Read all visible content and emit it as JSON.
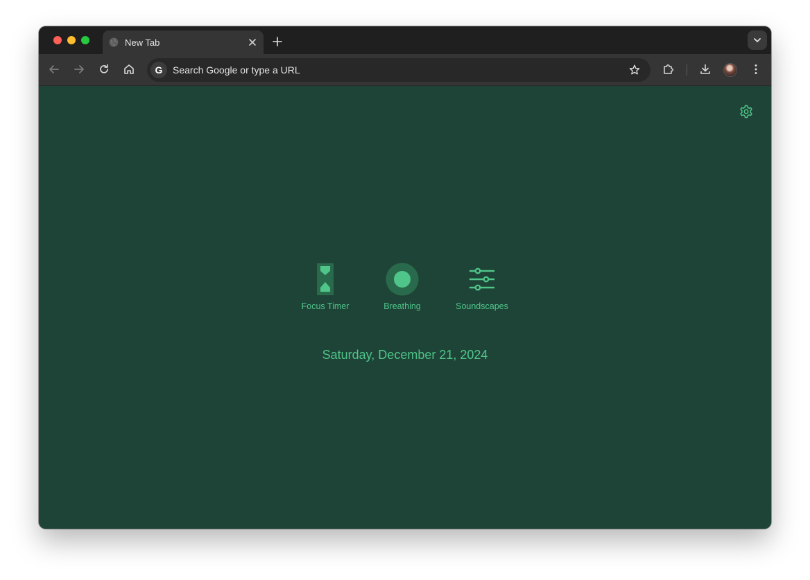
{
  "browser": {
    "tab": {
      "title": "New Tab"
    },
    "omnibox": {
      "placeholder": "Search Google or type a URL",
      "engine_logo": "G"
    }
  },
  "icons": {
    "back": "arrow-left-icon",
    "forward": "arrow-right-icon",
    "reload": "reload-icon",
    "home": "home-icon",
    "bookmark": "star-icon",
    "extensions": "puzzle-icon",
    "downloads": "download-icon",
    "menu": "kebab-menu-icon",
    "settings": "gear-icon"
  },
  "page": {
    "widgets": [
      {
        "label": "Focus Timer",
        "icon": "hourglass-icon"
      },
      {
        "label": "Breathing",
        "icon": "breathing-circle-icon"
      },
      {
        "label": "Soundscapes",
        "icon": "sliders-icon"
      }
    ],
    "date": "Saturday, December 21, 2024"
  },
  "colors": {
    "background": "#1e4437",
    "accent": "#4fc58a",
    "accent_dark": "#2a6a4c"
  }
}
